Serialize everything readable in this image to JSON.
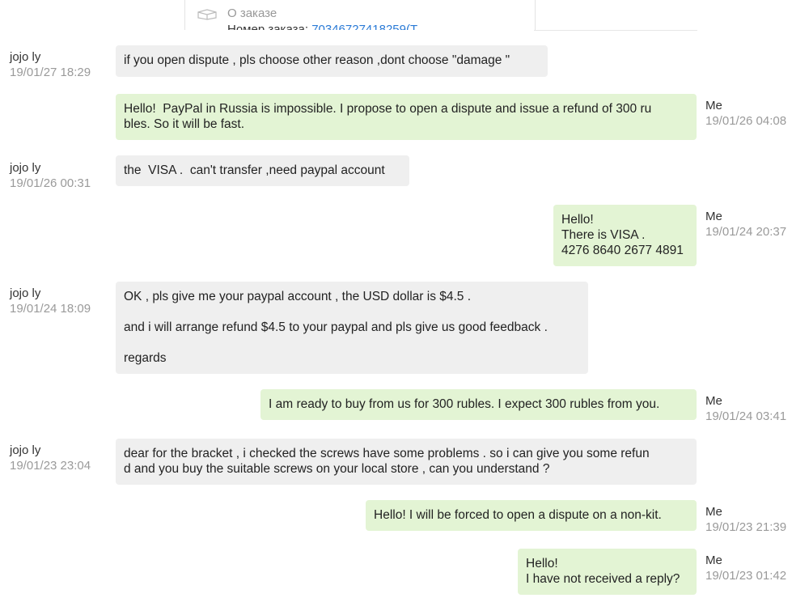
{
  "order_card": {
    "title": "О заказе",
    "number_label": "Номер заказа:",
    "number_value": "70346727418259(Т"
  },
  "messages": [
    {
      "sender": "jojo ly",
      "time": "19/01/27 18:29",
      "direction": "in",
      "lines": [
        "if you open dispute , pls choose other reason ,dont choose \"damage \""
      ]
    },
    {
      "sender": "Me",
      "time": "19/01/26 04:08",
      "direction": "out",
      "lines": [
        "Hello!  PayPal in Russia is impossible. I propose to open a dispute and issue a refund of 300 ru",
        "bles. So it will be fast."
      ]
    },
    {
      "sender": "jojo ly",
      "time": "19/01/26 00:31",
      "direction": "in",
      "lines": [
        "the  VISA .  can't transfer ,need paypal account"
      ]
    },
    {
      "sender": "Me",
      "time": "19/01/24 20:37",
      "direction": "out",
      "lines": [
        "Hello!",
        "There is VISA .",
        "4276 8640 2677 4891"
      ]
    },
    {
      "sender": "jojo ly",
      "time": "19/01/24 18:09",
      "direction": "in",
      "paragraphs": [
        "OK ,  pls give me your paypal account ,   the USD dollar is $4.5 .",
        "and i will arrange refund $4.5 to your paypal and pls give us good feedback .",
        "regards"
      ]
    },
    {
      "sender": "Me",
      "time": "19/01/24 03:41",
      "direction": "out",
      "lines": [
        "I am ready to buy from us for 300 rubles. I expect 300 rubles from you."
      ]
    },
    {
      "sender": "jojo ly",
      "time": "19/01/23 23:04",
      "direction": "in",
      "lines": [
        "dear for the bracket , i checked the screws have some problems . so i can give you some refun",
        "d and you buy the suitable screws on your local store , can you understand ?"
      ]
    },
    {
      "sender": "Me",
      "time": "19/01/23 21:39",
      "direction": "out",
      "lines": [
        "Hello! I will be forced to open a dispute on a non-kit."
      ]
    },
    {
      "sender": "Me",
      "time": "19/01/23 01:42",
      "direction": "out",
      "lines": [
        "Hello!",
        "I have not received a reply?"
      ]
    }
  ]
}
